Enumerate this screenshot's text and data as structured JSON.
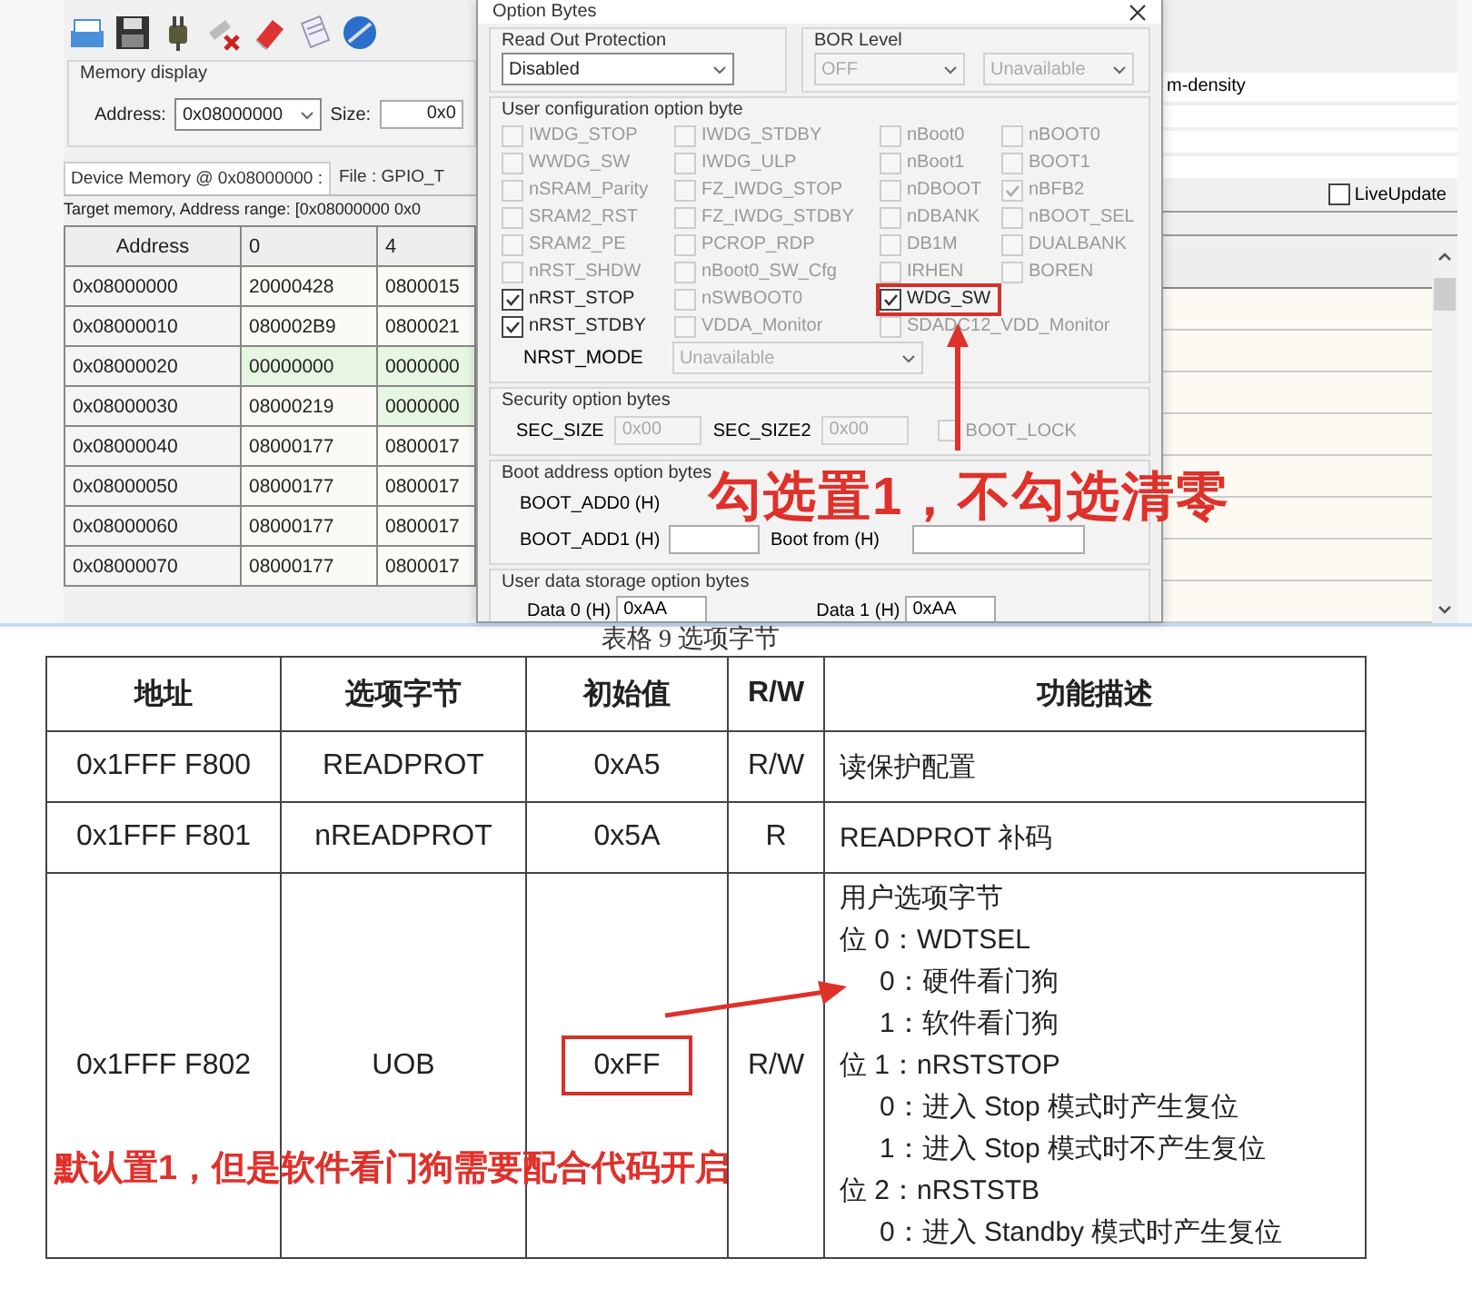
{
  "app": {
    "memory_display": {
      "title": "Memory display",
      "address_label": "Address:",
      "address": "0x08000000",
      "size_label": "Size:",
      "size": "0x0"
    },
    "tabs": [
      {
        "label": "Device Memory @ 0x08000000 :",
        "selected": true
      },
      {
        "label": "File : GPIO_T",
        "selected": false
      }
    ],
    "range_text": "Target memory, Address range: [0x08000000 0x0",
    "memory_table": {
      "columns": [
        "Address",
        "0",
        "4"
      ],
      "rows": [
        {
          "cells": [
            {
              "text": "0x08000000",
              "highlighted": false
            },
            {
              "text": "20000428",
              "highlighted": false
            },
            {
              "text": "0800015",
              "highlighted": false
            }
          ]
        },
        {
          "cells": [
            {
              "text": "0x08000010",
              "highlighted": false
            },
            {
              "text": "080002B9",
              "highlighted": false
            },
            {
              "text": "0800021",
              "highlighted": false
            }
          ]
        },
        {
          "cells": [
            {
              "text": "0x08000020",
              "highlighted": false
            },
            {
              "text": "00000000",
              "highlighted": true
            },
            {
              "text": "0000000",
              "highlighted": true
            }
          ]
        },
        {
          "cells": [
            {
              "text": "0x08000030",
              "highlighted": false
            },
            {
              "text": "08000219",
              "highlighted": false
            },
            {
              "text": "0000000",
              "highlighted": true
            }
          ]
        },
        {
          "cells": [
            {
              "text": "0x08000040",
              "highlighted": false
            },
            {
              "text": "08000177",
              "highlighted": false
            },
            {
              "text": "0800017",
              "highlighted": false
            }
          ]
        },
        {
          "cells": [
            {
              "text": "0x08000050",
              "highlighted": false
            },
            {
              "text": "08000177",
              "highlighted": false
            },
            {
              "text": "0800017",
              "highlighted": false
            }
          ]
        },
        {
          "cells": [
            {
              "text": "0x08000060",
              "highlighted": false
            },
            {
              "text": "08000177",
              "highlighted": false
            },
            {
              "text": "0800017",
              "highlighted": false
            }
          ]
        },
        {
          "cells": [
            {
              "text": "0x08000070",
              "highlighted": false
            },
            {
              "text": "08000177",
              "highlighted": false
            },
            {
              "text": "0800017",
              "highlighted": false
            }
          ]
        }
      ]
    },
    "device_field": "m-density",
    "live_update": {
      "label": "LiveUpdate",
      "checked": false
    }
  },
  "dialog": {
    "title": "Option Bytes",
    "read_out_protection": {
      "title": "Read Out Protection",
      "value": "Disabled",
      "disabled": false
    },
    "bor_level": {
      "title": "BOR Level",
      "selects": [
        {
          "value": "OFF",
          "disabled": true
        },
        {
          "value": "Unavailable",
          "disabled": true
        }
      ]
    },
    "user_config": {
      "title": "User configuration option byte",
      "rows": [
        [
          {
            "label": "IWDG_STOP",
            "checked": false,
            "disabled": true,
            "highlighted": false
          },
          {
            "label": "IWDG_STDBY",
            "checked": false,
            "disabled": true,
            "highlighted": false
          },
          {
            "label": "nBoot0",
            "checked": false,
            "disabled": true,
            "highlighted": false
          },
          {
            "label": "nBOOT0",
            "checked": false,
            "disabled": true,
            "highlighted": false
          }
        ],
        [
          {
            "label": "WWDG_SW",
            "checked": false,
            "disabled": true,
            "highlighted": false
          },
          {
            "label": "IWDG_ULP",
            "checked": false,
            "disabled": true,
            "highlighted": false
          },
          {
            "label": "nBoot1",
            "checked": false,
            "disabled": true,
            "highlighted": false
          },
          {
            "label": "BOOT1",
            "checked": false,
            "disabled": true,
            "highlighted": false
          }
        ],
        [
          {
            "label": "nSRAM_Parity",
            "checked": false,
            "disabled": true,
            "highlighted": false
          },
          {
            "label": "FZ_IWDG_STOP",
            "checked": false,
            "disabled": true,
            "highlighted": false
          },
          {
            "label": "nDBOOT",
            "checked": false,
            "disabled": true,
            "highlighted": false
          },
          {
            "label": "nBFB2",
            "checked": true,
            "disabled": true,
            "highlighted": false
          }
        ],
        [
          {
            "label": "SRAM2_RST",
            "checked": false,
            "disabled": true,
            "highlighted": false
          },
          {
            "label": "FZ_IWDG_STDBY",
            "checked": false,
            "disabled": true,
            "highlighted": false
          },
          {
            "label": "nDBANK",
            "checked": false,
            "disabled": true,
            "highlighted": false
          },
          {
            "label": "nBOOT_SEL",
            "checked": false,
            "disabled": true,
            "highlighted": false
          }
        ],
        [
          {
            "label": "SRAM2_PE",
            "checked": false,
            "disabled": true,
            "highlighted": false
          },
          {
            "label": "PCROP_RDP",
            "checked": false,
            "disabled": true,
            "highlighted": false
          },
          {
            "label": "DB1M",
            "checked": false,
            "disabled": true,
            "highlighted": false
          },
          {
            "label": "DUALBANK",
            "checked": false,
            "disabled": true,
            "highlighted": false
          }
        ],
        [
          {
            "label": "nRST_SHDW",
            "checked": false,
            "disabled": true,
            "highlighted": false
          },
          {
            "label": "nBoot0_SW_Cfg",
            "checked": false,
            "disabled": true,
            "highlighted": false
          },
          {
            "label": "IRHEN",
            "checked": false,
            "disabled": true,
            "highlighted": false
          },
          {
            "label": "BOREN",
            "checked": false,
            "disabled": true,
            "highlighted": false
          }
        ],
        [
          {
            "label": "nRST_STOP",
            "checked": true,
            "disabled": false,
            "highlighted": false
          },
          {
            "label": "nSWBOOT0",
            "checked": false,
            "disabled": true,
            "highlighted": false
          },
          {
            "label": "WDG_SW",
            "checked": true,
            "disabled": false,
            "highlighted": true
          }
        ],
        [
          {
            "label": "nRST_STDBY",
            "checked": true,
            "disabled": false,
            "highlighted": false
          },
          {
            "label": "VDDA_Monitor",
            "checked": false,
            "disabled": true,
            "highlighted": false
          },
          {
            "label": "SDADC12_VDD_Monitor",
            "checked": false,
            "disabled": true,
            "highlighted": false
          }
        ]
      ],
      "nrst_mode": {
        "label": "NRST_MODE",
        "value": "Unavailable",
        "disabled": true
      }
    },
    "security": {
      "title": "Security option bytes",
      "fields": [
        {
          "label": "SEC_SIZE",
          "value": "0x00",
          "disabled": true
        },
        {
          "label": "SEC_SIZE2",
          "value": "0x00",
          "disabled": true
        }
      ],
      "boot_lock": {
        "label": "BOOT_LOCK",
        "checked": false,
        "disabled": true
      }
    },
    "boot_address": {
      "title": "Boot address option bytes",
      "rows": [
        {
          "label": "BOOT_ADD0 (H)"
        },
        {
          "label": "BOOT_ADD1 (H)",
          "from_label": "Boot from (H)"
        }
      ]
    },
    "user_data": {
      "title": "User data storage option bytes",
      "fields": [
        {
          "label": "Data 0 (H)",
          "value": "0xAA"
        },
        {
          "label": "Data 1 (H)",
          "value": "0xAA"
        }
      ]
    }
  },
  "dialog_note": "勾选置1，不勾选清零",
  "doc_table": {
    "caption": "表格 9 选项字节",
    "columns": [
      "地址",
      "选项字节",
      "初始值",
      "R/W",
      "功能描述"
    ],
    "rows": [
      {
        "address": "0x1FFF F800",
        "name": "READPROT",
        "default": "0xA5",
        "highlighted": false,
        "access": "R/W",
        "description": [
          {
            "text": "读保护配置"
          }
        ]
      },
      {
        "address": "0x1FFF F801",
        "name": "nREADPROT",
        "default": "0x5A",
        "highlighted": false,
        "access": "R",
        "description": [
          {
            "text": "READPROT 补码"
          }
        ]
      },
      {
        "address": "0x1FFF F802",
        "name": "UOB",
        "default": "0xFF",
        "highlighted": true,
        "access": "R/W",
        "description": [
          {
            "text": "用户选项字节"
          },
          {
            "text": "位 0：WDTSEL",
            "children": [
              {
                "text": "0：硬件看门狗"
              },
              {
                "text": "1：软件看门狗"
              }
            ]
          },
          {
            "text": "位 1：nRSTSTOP",
            "children": [
              {
                "text": "0：进入 Stop 模式时产生复位"
              },
              {
                "text": "1：进入 Stop 模式时不产生复位"
              }
            ]
          },
          {
            "text": "位 2：nRSTSTB",
            "children": [
              {
                "text": "0：进入 Standby 模式时产生复位"
              }
            ]
          }
        ]
      }
    ]
  },
  "table_note": "默认置1，但是软件看门狗需要配合代码开启"
}
